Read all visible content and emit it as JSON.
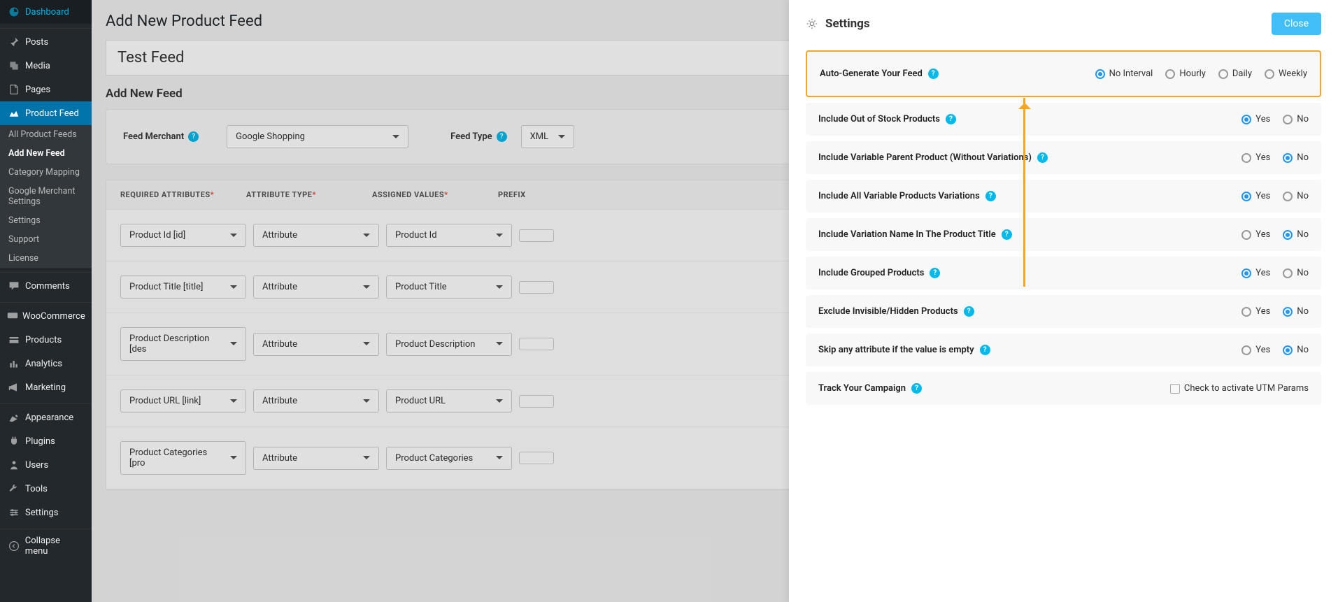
{
  "sidebar": {
    "items": [
      {
        "label": "Dashboard",
        "id": "sidebar-dashboard"
      },
      {
        "label": "Posts",
        "id": "sidebar-posts"
      },
      {
        "label": "Media",
        "id": "sidebar-media"
      },
      {
        "label": "Pages",
        "id": "sidebar-pages"
      },
      {
        "label": "Product Feed",
        "id": "sidebar-product-feed"
      },
      {
        "label": "Comments",
        "id": "sidebar-comments"
      },
      {
        "label": "WooCommerce",
        "id": "sidebar-woocommerce"
      },
      {
        "label": "Products",
        "id": "sidebar-products"
      },
      {
        "label": "Analytics",
        "id": "sidebar-analytics"
      },
      {
        "label": "Marketing",
        "id": "sidebar-marketing"
      },
      {
        "label": "Appearance",
        "id": "sidebar-appearance"
      },
      {
        "label": "Plugins",
        "id": "sidebar-plugins"
      },
      {
        "label": "Users",
        "id": "sidebar-users"
      },
      {
        "label": "Tools",
        "id": "sidebar-tools"
      },
      {
        "label": "Settings",
        "id": "sidebar-settings"
      },
      {
        "label": "Collapse menu",
        "id": "sidebar-collapse"
      }
    ],
    "sub": [
      {
        "label": "All Product Feeds"
      },
      {
        "label": "Add New Feed"
      },
      {
        "label": "Category Mapping"
      },
      {
        "label": "Google Merchant Settings"
      },
      {
        "label": "Settings"
      },
      {
        "label": "Support"
      },
      {
        "label": "License"
      }
    ]
  },
  "page": {
    "title": "Add New Product Feed",
    "feed_name": "Test Feed",
    "section": "Add New Feed",
    "merchant_label": "Feed Merchant",
    "merchant_value": "Google Shopping",
    "type_label": "Feed Type",
    "type_value": "XML"
  },
  "table": {
    "headers": {
      "req": "REQUIRED ATTRIBUTES",
      "type": "ATTRIBUTE TYPE",
      "val": "ASSIGNED VALUES",
      "prefix": "PREFIX"
    },
    "rows": [
      {
        "req": "Product Id [id]",
        "type": "Attribute",
        "val": "Product Id"
      },
      {
        "req": "Product Title [title]",
        "type": "Attribute",
        "val": "Product Title"
      },
      {
        "req": "Product Description [des",
        "type": "Attribute",
        "val": "Product Description"
      },
      {
        "req": "Product URL [link]",
        "type": "Attribute",
        "val": "Product URL"
      },
      {
        "req": "Product Categories [pro",
        "type": "Attribute",
        "val": "Product Categories"
      }
    ]
  },
  "panel": {
    "title": "Settings",
    "close": "Close",
    "rows": [
      {
        "label": "Auto-Generate Your Feed",
        "type": "radio4",
        "opts": [
          "No Interval",
          "Hourly",
          "Daily",
          "Weekly"
        ],
        "selected": 0,
        "highlight": true
      },
      {
        "label": "Include Out of Stock Products",
        "type": "yesno",
        "selected": "yes"
      },
      {
        "label": "Include Variable Parent Product (Without Variations)",
        "type": "yesno",
        "selected": "no"
      },
      {
        "label": "Include All Variable Products Variations",
        "type": "yesno",
        "selected": "yes"
      },
      {
        "label": "Include Variation Name In The Product Title",
        "type": "yesno",
        "selected": "no"
      },
      {
        "label": "Include Grouped Products",
        "type": "yesno",
        "selected": "yes"
      },
      {
        "label": "Exclude Invisible/Hidden Products",
        "type": "yesno",
        "selected": "no"
      },
      {
        "label": "Skip any attribute if the value is empty",
        "type": "yesno",
        "selected": "no"
      },
      {
        "label": "Track Your Campaign",
        "type": "checkbox",
        "check_label": "Check to activate UTM Params"
      }
    ],
    "yes": "Yes",
    "no": "No"
  }
}
